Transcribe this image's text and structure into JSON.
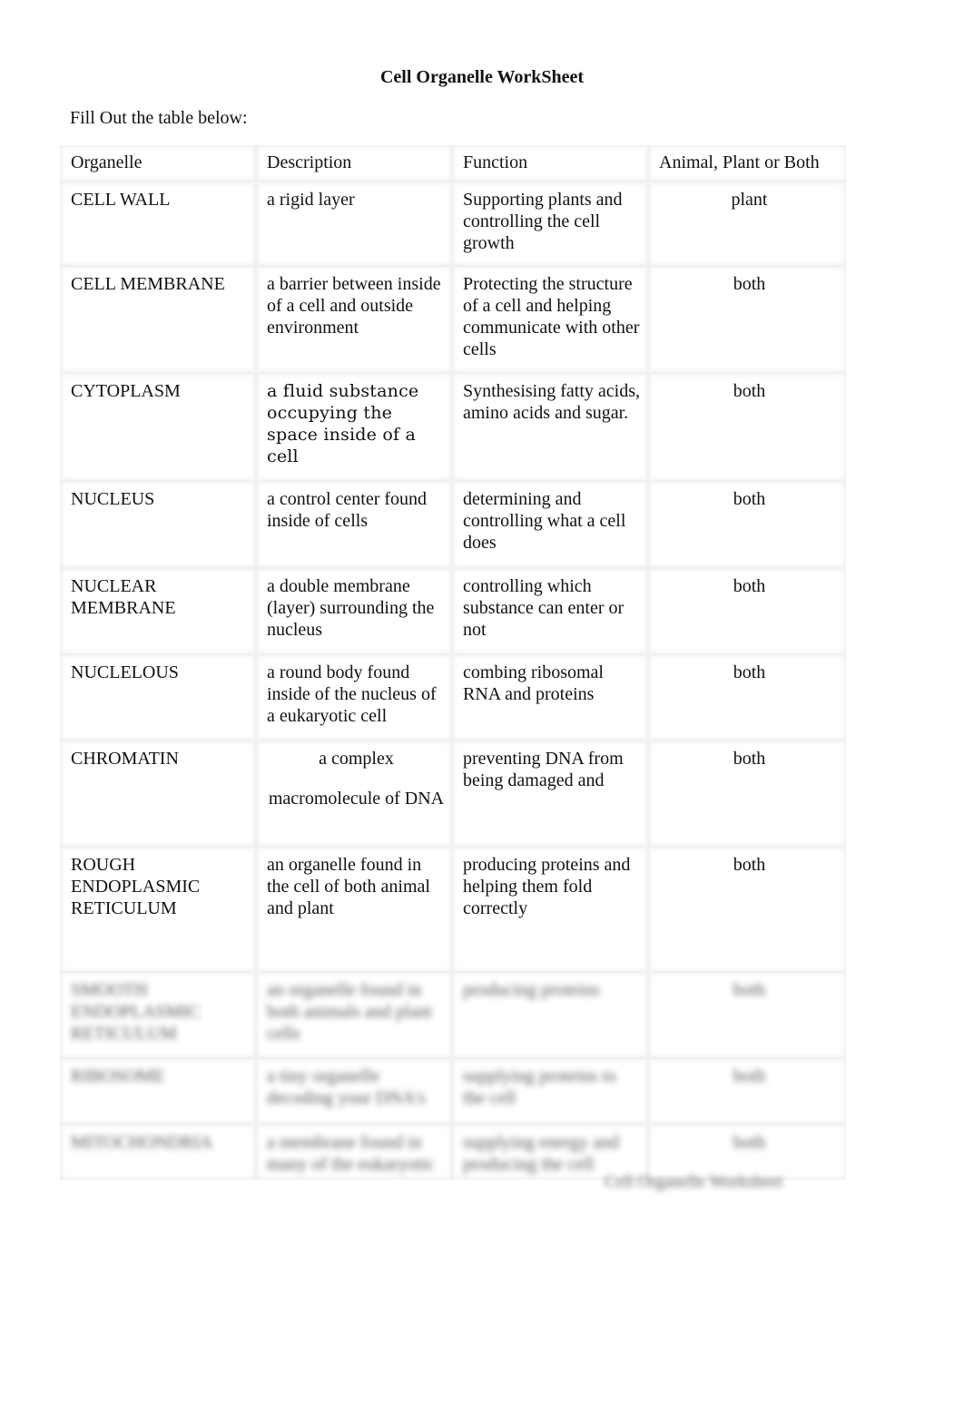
{
  "document": {
    "title": "Cell Organelle WorkSheet",
    "instructions": "Fill Out the table below:",
    "footer": "Cell Organelle Worksheet"
  },
  "table": {
    "headers": [
      "Organelle",
      "Description",
      "Function",
      "Animal, Plant or Both"
    ],
    "rows": [
      {
        "organelle": "CELL WALL",
        "description": "a rigid layer",
        "function": "Supporting plants and controlling the cell growth",
        "type": "plant"
      },
      {
        "organelle": "CELL MEMBRANE",
        "description": "a barrier between inside of a cell and outside environment",
        "function": "Protecting the structure of a cell and helping communicate with other cells",
        "type": "both"
      },
      {
        "organelle": "CYTOPLASM",
        "description": "a fluid substance occupying the space inside of a cell",
        "function": "Synthesising fatty acids, amino acids and sugar.",
        "type": "both"
      },
      {
        "organelle": "NUCLEUS",
        "description": "a control center found inside of cells",
        "function": "determining and controlling what a cell does",
        "type": "both"
      },
      {
        "organelle": "NUCLEAR MEMBRANE",
        "description": "a double membrane (layer) surrounding the nucleus",
        "function": "controlling which substance can enter or not",
        "type": "both"
      },
      {
        "organelle": "NUCLELOUS",
        "description": "a round body found inside of the nucleus of a eukaryotic cell",
        "function": "combing ribosomal RNA and proteins",
        "type": "both"
      },
      {
        "organelle": "CHROMATIN",
        "description_line1": "a complex",
        "description_line2": "macromolecule of DNA",
        "function": "preventing DNA from being damaged and",
        "type": "both"
      },
      {
        "organelle": "ROUGH ENDOPLASMIC RETICULUM",
        "description": "an organelle found in the cell of both animal and plant",
        "function": "producing proteins and helping them fold correctly",
        "type": "both"
      },
      {
        "organelle": "SMOOTH ENDOPLASMIC RETICULUM",
        "description": "an organelle found in both animals and plant cells",
        "function": "producing proteins",
        "type": "both"
      },
      {
        "organelle": "RIBOSOME",
        "description": "a tiny organelle decoding your DNA's",
        "function": "supplying proteins to the cell",
        "type": "both"
      },
      {
        "organelle": "MITOCHONDRIA",
        "description": "a membrane found in many of the eukaryotic",
        "function": "supplying energy and producing the cell",
        "type": "both"
      }
    ]
  }
}
